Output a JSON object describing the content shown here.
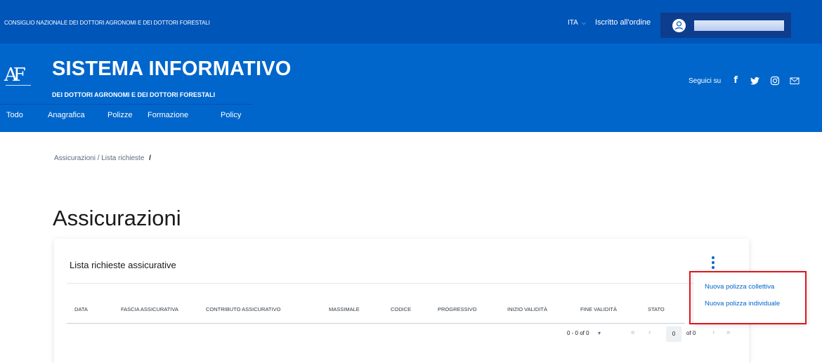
{
  "topbar": {
    "org_name": "CONSIGLIO NAZIONALE DEI DOTTORI AGRONOMI E DEI DOTTORI FORESTALI",
    "language": "ITA",
    "iscritto_label": "Iscritto all'ordine",
    "avatar_icon": "user-icon",
    "bg_color": "#0055b8"
  },
  "header": {
    "logo_text": "AF",
    "title": "SISTEMA INFORMATIVO",
    "subtitle": "DEI DOTTORI AGRONOMI E DEI DOTTORI FORESTALI",
    "social_label": "Seguici su",
    "social_icons": [
      "facebook-icon",
      "twitter-icon",
      "instagram-icon",
      "mail-icon"
    ],
    "bg_color": "#0066cc"
  },
  "nav": {
    "items": [
      "Todo",
      "Anagrafica",
      "Polizze",
      "Formazione",
      "Policy"
    ]
  },
  "breadcrumb": {
    "path": "Assicurazioni / Lista richieste",
    "trailing_sep": "/"
  },
  "page": {
    "title": "Assicurazioni"
  },
  "card": {
    "title": "Lista richieste assicurative",
    "columns": [
      "DATA",
      "FASCIA ASSICURATIVA",
      "CONTRIBUTO ASSICURATIVO",
      "MASSIMALE",
      "CODICE",
      "PROGRESSIVO",
      "INIZIO VALIDITÀ",
      "FINE VALIDITÀ",
      "STATO"
    ],
    "pagination": {
      "range": "0 - 0 of 0",
      "first": "«",
      "prev": "‹",
      "current_page": "0",
      "of_pages": "of 0",
      "next": "›",
      "last": "»"
    }
  },
  "dropdown": {
    "items": [
      "Nuova polizza collettiva",
      "Nuova polizza individuale"
    ],
    "highlight_color": "#e0151b"
  }
}
